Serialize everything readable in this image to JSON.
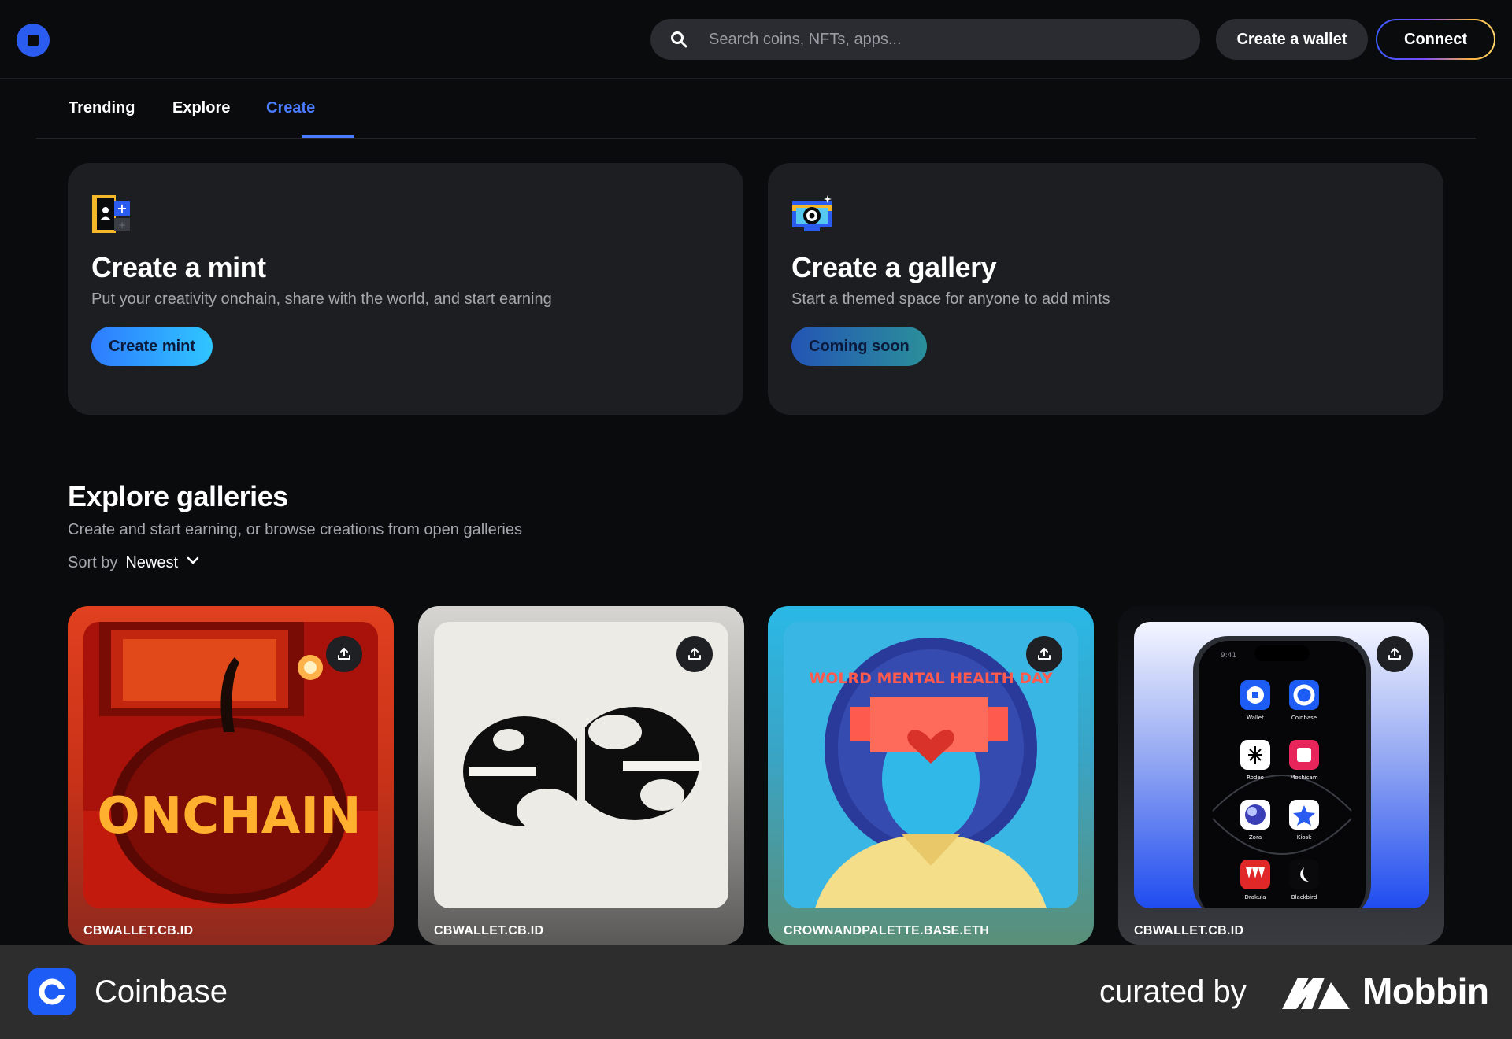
{
  "header": {
    "search_placeholder": "Search coins, NFTs, apps...",
    "create_wallet_label": "Create a wallet",
    "connect_label": "Connect"
  },
  "tabs": [
    {
      "label": "Trending"
    },
    {
      "label": "Explore"
    },
    {
      "label": "Create",
      "active": true
    }
  ],
  "create_cards": [
    {
      "icon": "mint-id-card-icon",
      "title": "Create a mint",
      "subtitle": "Put your creativity onchain, share with the world, and start earning",
      "button_label": "Create mint"
    },
    {
      "icon": "gallery-camera-icon",
      "title": "Create a gallery",
      "subtitle": "Start a themed space for anyone to add mints",
      "button_label": "Coming soon"
    }
  ],
  "explore": {
    "title": "Explore galleries",
    "subtitle": "Create and start earning, or browse creations from open galleries",
    "sort_label": "Sort by",
    "sort_value": "Newest"
  },
  "galleries": [
    {
      "owner": "CBWALLET.CB.ID",
      "image_text": "ONCHAIN",
      "theme": "#d8321c"
    },
    {
      "owner": "CBWALLET.CB.ID",
      "image_text": "",
      "theme": "#d9d7d2"
    },
    {
      "owner": "CROWNANDPALETTE.BASE.ETH",
      "image_text": "WOLRD MENTAL HEALTH DAY",
      "theme": "#2ab4e0"
    },
    {
      "owner": "CBWALLET.CB.ID",
      "image_text": "",
      "theme": "#2a5cf0",
      "phone_time": "9:41",
      "phone_apps": [
        "Wallet",
        "Coinbase",
        "Rodeo",
        "Moshicam",
        "Zora",
        "Kiosk",
        "Drakula",
        "Blackbird"
      ]
    }
  ],
  "footer": {
    "brand": "Coinbase",
    "curated_by": "curated by",
    "curator": "Mobbin"
  }
}
